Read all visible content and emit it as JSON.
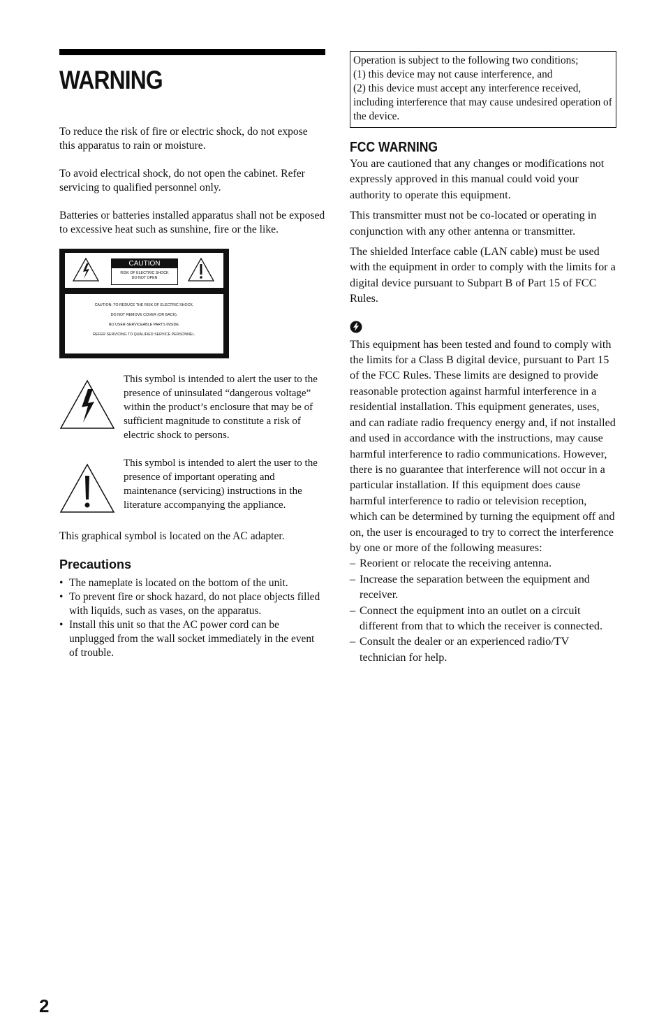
{
  "left": {
    "title": "WARNING",
    "paragraphs": [
      "To reduce the risk of fire or electric shock, do not expose this apparatus to rain or moisture.",
      "To avoid electrical shock, do not open the cabinet. Refer servicing to qualified personnel only.",
      "Batteries or batteries installed apparatus shall not be exposed to excessive heat such as sunshine, fire or the like."
    ],
    "caution_label": {
      "header": "CAUTION",
      "sub1": "RISK OF ELECTRIC SHOCK",
      "sub2": "DO NOT OPEN",
      "lines": [
        "CAUTION: TO REDUCE THE RISK OF ELECTRIC SHOCK,",
        "DO NOT REMOVE COVER (OR BACK).",
        "NO USER-SERVICEABLE PARTS INSIDE.",
        "REFER SERVICING TO QUALIFIED SERVICE PERSONNEL."
      ]
    },
    "symbols": [
      {
        "icon": "lightning-triangle-icon",
        "text": "This symbol is intended to alert the user to the presence of uninsulated “dangerous voltage” within the product’s enclosure that may be of sufficient magnitude to constitute a risk of electric shock to persons."
      },
      {
        "icon": "exclamation-triangle-icon",
        "text": "This symbol is intended to alert the user to the presence of important operating and maintenance (servicing) instructions in the literature accompanying the appliance."
      }
    ],
    "symbol_location": "This graphical symbol is located on the AC adapter.",
    "precautions_heading": "Precautions",
    "precautions": [
      "The nameplate is located on the bottom of the unit.",
      "To prevent fire or shock hazard, do not place objects filled with liquids, such as vases, on the apparatus.",
      "Install this unit so that the AC power cord can be unplugged from the wall socket immediately in the event of trouble."
    ]
  },
  "right": {
    "conditions_box": [
      "Operation is subject to the following two conditions;",
      "(1) this device may not cause interference, and",
      "(2) this device must accept any interference received, including interference that may cause undesired operation of the device."
    ],
    "fcc_heading": "FCC WARNING",
    "fcc_paragraphs": [
      "You are cautioned that any changes or modifications not expressly approved in this manual could void your authority to operate this equipment.",
      "This transmitter must not be co-located or operating in conjunction with any other antenna or transmitter.",
      "The shielded Interface cable (LAN cable) must be used with the equipment in order to comply with the limits for a digital device pursuant to Subpart B of Part 15 of FCC Rules."
    ],
    "note_icon": "note-lightning-icon",
    "note_text": "This equipment has been tested and found to comply with the limits for a Class B digital device, pursuant to Part 15 of the FCC Rules. These limits are designed to provide reasonable protection against harmful interference in a residential installation. This equipment generates, uses, and can radiate radio frequency energy and, if not installed and used in accordance with the instructions, may cause harmful interference to radio communications. However, there is no guarantee that interference will not occur in a particular installation. If this equipment does cause harmful interference to radio or television reception, which can be determined by turning the equipment off and on, the user is encouraged to try to correct the interference by one or more of the following measures:",
    "measures": [
      "Reorient or relocate the receiving antenna.",
      "Increase the separation between the equipment and receiver.",
      "Connect the equipment into an outlet on a circuit different from that to which the receiver is connected.",
      "Consult the dealer or an experienced radio/TV technician for help."
    ]
  },
  "page_number": "2"
}
